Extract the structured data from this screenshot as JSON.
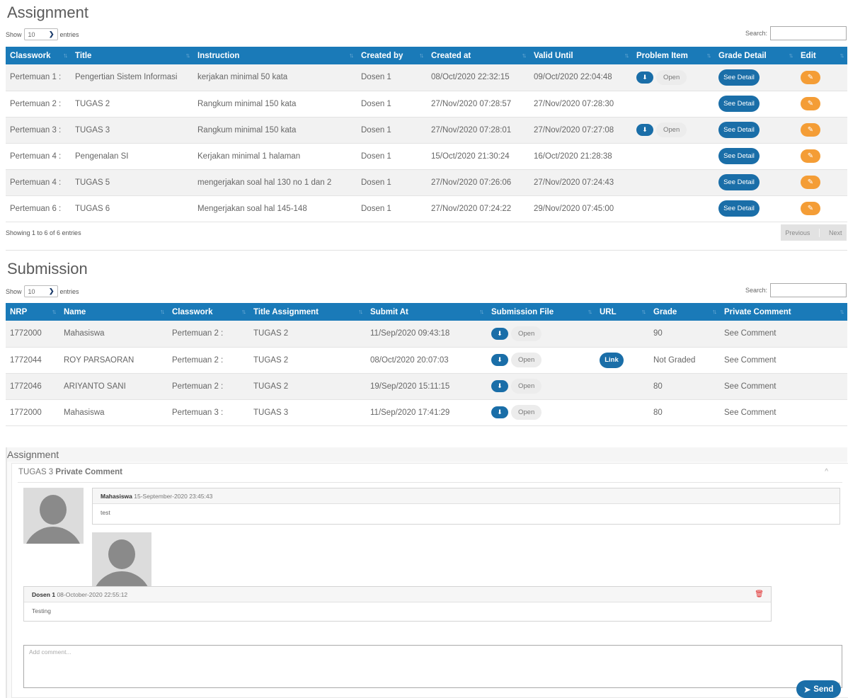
{
  "assignment": {
    "title": "Assignment",
    "show_label": "Show",
    "entries_value": "10",
    "entries_label": "entries",
    "search_label": "Search:",
    "search_value": "",
    "columns": [
      "Classwork",
      "Title",
      "Instruction",
      "Created by",
      "Created at",
      "Valid Until",
      "Problem Item",
      "Grade Detail",
      "Edit"
    ],
    "rows": [
      {
        "classwork": "Pertemuan 1 :",
        "title": "Pengertian Sistem Informasi",
        "instruction": "kerjakan minimal 50 kata",
        "created_by": "Dosen 1",
        "created_at": "08/Oct/2020 22:32:15",
        "valid_until": "09/Oct/2020 22:04:48",
        "has_file": true,
        "open_label": "Open",
        "detail_label": "See Detail"
      },
      {
        "classwork": "Pertemuan 2 :",
        "title": "TUGAS 2",
        "instruction": "Rangkum minimal 150 kata",
        "created_by": "Dosen 1",
        "created_at": "27/Nov/2020 07:28:57",
        "valid_until": "27/Nov/2020 07:28:30",
        "has_file": false,
        "open_label": "",
        "detail_label": "See Detail"
      },
      {
        "classwork": "Pertemuan 3 :",
        "title": "TUGAS 3",
        "instruction": "Rangkum minimal 150 kata",
        "created_by": "Dosen 1",
        "created_at": "27/Nov/2020 07:28:01",
        "valid_until": "27/Nov/2020 07:27:08",
        "has_file": true,
        "open_label": "Open",
        "detail_label": "See Detail"
      },
      {
        "classwork": "Pertemuan 4 :",
        "title": "Pengenalan SI",
        "instruction": "Kerjakan minimal 1 halaman",
        "created_by": "Dosen 1",
        "created_at": "15/Oct/2020 21:30:24",
        "valid_until": "16/Oct/2020 21:28:38",
        "has_file": false,
        "open_label": "",
        "detail_label": "See Detail"
      },
      {
        "classwork": "Pertemuan 4 :",
        "title": "TUGAS 5",
        "instruction": "mengerjakan soal hal 130 no 1 dan 2",
        "created_by": "Dosen 1",
        "created_at": "27/Nov/2020 07:26:06",
        "valid_until": "27/Nov/2020 07:24:43",
        "has_file": false,
        "open_label": "",
        "detail_label": "See Detail"
      },
      {
        "classwork": "Pertemuan 6 :",
        "title": "TUGAS 6",
        "instruction": "Mengerjakan soal hal 145-148",
        "created_by": "Dosen 1",
        "created_at": "27/Nov/2020 07:24:22",
        "valid_until": "29/Nov/2020 07:45:00",
        "has_file": false,
        "open_label": "",
        "detail_label": "See Detail"
      }
    ],
    "info": "Showing 1 to 6 of 6 entries",
    "prev_label": "Previous",
    "next_label": "Next"
  },
  "submission": {
    "title": "Submission",
    "show_label": "Show",
    "entries_value": "10",
    "entries_label": "entries",
    "search_label": "Search:",
    "search_value": "",
    "columns": [
      "NRP",
      "Name",
      "Classwork",
      "Title Assignment",
      "Submit At",
      "Submission File",
      "URL",
      "Grade",
      "Private Comment"
    ],
    "rows": [
      {
        "nrp": "1772000",
        "name": "Mahasiswa",
        "classwork": "Pertemuan 2 :",
        "title": "TUGAS 2",
        "submit_at": "11/Sep/2020 09:43:18",
        "open_label": "Open",
        "url_label": "",
        "grade": "90",
        "comment": "See Comment"
      },
      {
        "nrp": "1772044",
        "name": "ROY PARSAORAN",
        "classwork": "Pertemuan 2 :",
        "title": "TUGAS 2",
        "submit_at": "08/Oct/2020 20:07:03",
        "open_label": "Open",
        "url_label": "Link",
        "grade": "Not Graded",
        "comment": "See Comment"
      },
      {
        "nrp": "1772046",
        "name": "ARIYANTO SANI",
        "classwork": "Pertemuan 2 :",
        "title": "TUGAS 2",
        "submit_at": "19/Sep/2020 15:11:15",
        "open_label": "Open",
        "url_label": "",
        "grade": "80",
        "comment": "See Comment"
      },
      {
        "nrp": "1772000",
        "name": "Mahasiswa",
        "classwork": "Pertemuan 3 :",
        "title": "TUGAS 3",
        "submit_at": "11/Sep/2020 17:41:29",
        "open_label": "Open",
        "url_label": "",
        "grade": "80",
        "comment": "See Comment"
      }
    ]
  },
  "comments": {
    "panel_title": "Assignment",
    "box_title_prefix": "TUGAS 3",
    "box_title_strong": "Private Comment",
    "messages": [
      {
        "author": "Mahasiswa",
        "date": "15-September-2020 23:45:43",
        "text": "test"
      },
      {
        "author": "Dosen 1",
        "date": "08-October-2020 22:55:12",
        "text": "Testing"
      }
    ],
    "input_placeholder": "Add comment...",
    "send_label": "Send"
  },
  "icons": {
    "download": "download-icon",
    "edit": "edit-icon",
    "trash": "trash-icon",
    "send": "paper-plane-icon",
    "sort": "sort-icon",
    "collapse": "chevron-up-icon"
  },
  "colors": {
    "header_blue": "#1a7ab8",
    "button_blue": "#1a6ea8",
    "edit_orange": "#f49d36",
    "delete_red": "#e02828"
  }
}
